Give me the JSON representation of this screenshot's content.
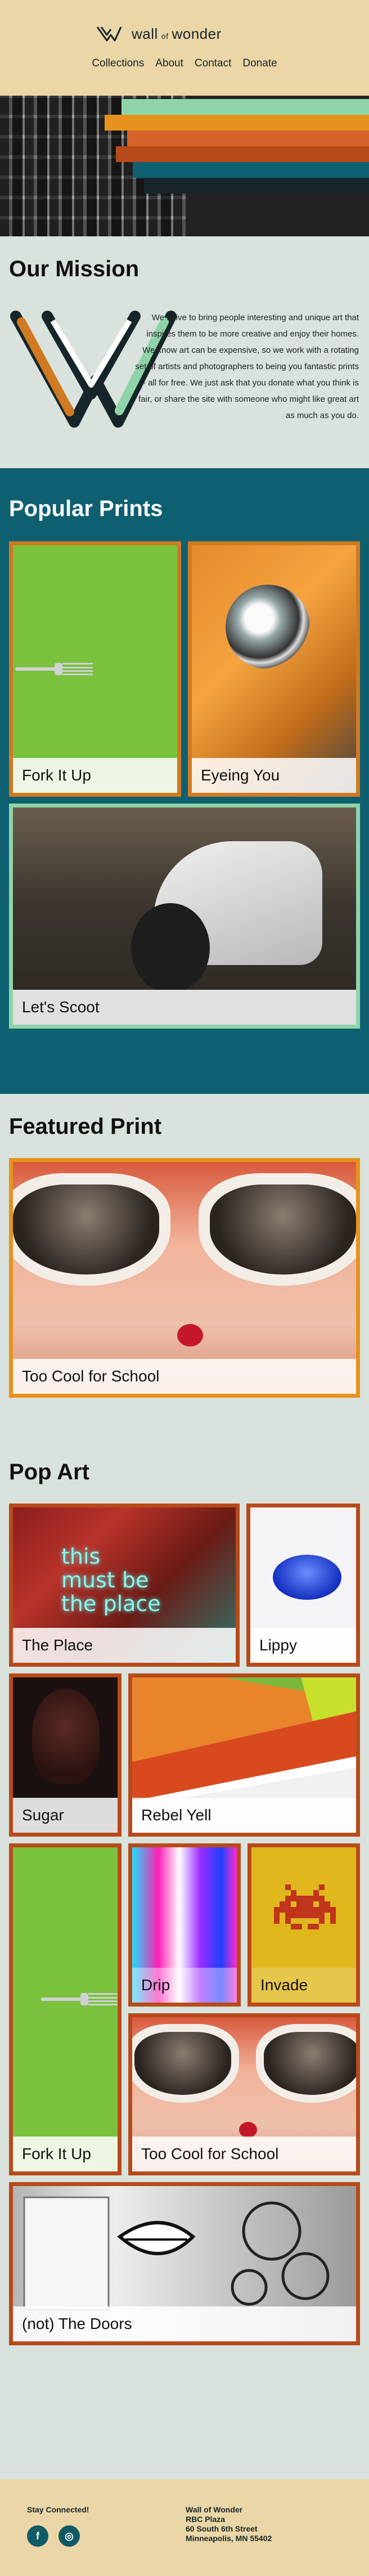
{
  "header": {
    "brand": {
      "main": "wall",
      "small": "of",
      "end": "wonder"
    },
    "nav": [
      "Collections",
      "About",
      "Contact",
      "Donate"
    ]
  },
  "colors": {
    "header_bg": "#ead6a6",
    "teal": "#0e6070",
    "orange": "#d07a22",
    "rust": "#b84a1a",
    "mint": "#8fd4a8"
  },
  "mission": {
    "title": "Our Mission",
    "body": "We strive to bring people interesting and unique art that inspires them to be more creative and enjoy their homes. We know art can be expensive, so we work with a rotating set of artists and photographers to being you fantastic prints - all for free. We just ask that you donate what you think is fair, or share the site with someone who might like great art as much as you do."
  },
  "popular": {
    "title": "Popular Prints",
    "items": [
      "Fork It Up",
      "Eyeing You",
      "Let's Scoot"
    ]
  },
  "featured": {
    "title": "Featured Print",
    "caption": "Too Cool for School"
  },
  "popart": {
    "title": "Pop Art",
    "neon_text": [
      "this",
      "must be",
      "the place"
    ],
    "items": [
      "The Place",
      "Lippy",
      "Sugar",
      "Rebel Yell",
      "Drip",
      "Invade",
      "Fork It Up",
      "Too Cool for School",
      "(not) The Doors"
    ]
  },
  "footer": {
    "stay": "Stay Connected!",
    "social": [
      {
        "icon": "facebook-icon",
        "glyph": "f"
      },
      {
        "icon": "instagram-icon",
        "glyph": "◎"
      }
    ],
    "address": [
      "Wall of Wonder",
      "RBC Plaza",
      "60 South 6th Street",
      "Minneapolis, MN 55402"
    ]
  }
}
